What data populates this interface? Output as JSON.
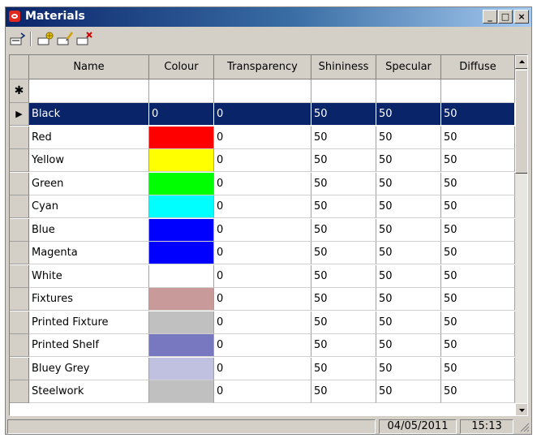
{
  "window": {
    "title": "Materials",
    "controls": {
      "minimize": "_",
      "maximize": "□",
      "close": "×"
    }
  },
  "toolbar": {
    "icons": [
      "toggle-view-icon",
      "add-material-icon",
      "edit-material-icon",
      "delete-material-icon"
    ]
  },
  "grid": {
    "columns": [
      "Name",
      "Colour",
      "Transparency",
      "Shininess",
      "Specular",
      "Diffuse"
    ],
    "new_row_marker": "✱",
    "current_row_marker": "▶",
    "rows": [
      {
        "name": "Black",
        "colour": "0",
        "swatch": "",
        "transparency": "0",
        "shininess": "50",
        "specular": "50",
        "diffuse": "50",
        "selected": true
      },
      {
        "name": "Red",
        "colour": "",
        "swatch": "#ff0000",
        "transparency": "0",
        "shininess": "50",
        "specular": "50",
        "diffuse": "50"
      },
      {
        "name": "Yellow",
        "colour": "",
        "swatch": "#ffff00",
        "transparency": "0",
        "shininess": "50",
        "specular": "50",
        "diffuse": "50"
      },
      {
        "name": "Green",
        "colour": "",
        "swatch": "#00ff00",
        "transparency": "0",
        "shininess": "50",
        "specular": "50",
        "diffuse": "50"
      },
      {
        "name": "Cyan",
        "colour": "",
        "swatch": "#00ffff",
        "transparency": "0",
        "shininess": "50",
        "specular": "50",
        "diffuse": "50"
      },
      {
        "name": "Blue",
        "colour": "",
        "swatch": "#0000ff",
        "transparency": "0",
        "shininess": "50",
        "specular": "50",
        "diffuse": "50"
      },
      {
        "name": "Magenta",
        "colour": "",
        "swatch": "#0000ff",
        "transparency": "0",
        "shininess": "50",
        "specular": "50",
        "diffuse": "50"
      },
      {
        "name": "White",
        "colour": "",
        "swatch": "#ffffff",
        "transparency": "0",
        "shininess": "50",
        "specular": "50",
        "diffuse": "50"
      },
      {
        "name": "Fixtures",
        "colour": "",
        "swatch": "#c89a9a",
        "transparency": "0",
        "shininess": "50",
        "specular": "50",
        "diffuse": "50"
      },
      {
        "name": "Printed Fixture",
        "colour": "",
        "swatch": "#c0c0c0",
        "transparency": "0",
        "shininess": "50",
        "specular": "50",
        "diffuse": "50"
      },
      {
        "name": "Printed Shelf",
        "colour": "",
        "swatch": "#7878c0",
        "transparency": "0",
        "shininess": "50",
        "specular": "50",
        "diffuse": "50"
      },
      {
        "name": "Bluey Grey",
        "colour": "",
        "swatch": "#c0c0e0",
        "transparency": "0",
        "shininess": "50",
        "specular": "50",
        "diffuse": "50"
      },
      {
        "name": "Steelwork",
        "colour": "",
        "swatch": "#c0c0c0",
        "transparency": "0",
        "shininess": "50",
        "specular": "50",
        "diffuse": "50"
      }
    ]
  },
  "statusbar": {
    "message": "",
    "date": "04/05/2011",
    "time": "15:13"
  },
  "colors": {
    "title_start": "#0a246a",
    "selection": "#0a246a",
    "chrome": "#d4d0c8"
  }
}
